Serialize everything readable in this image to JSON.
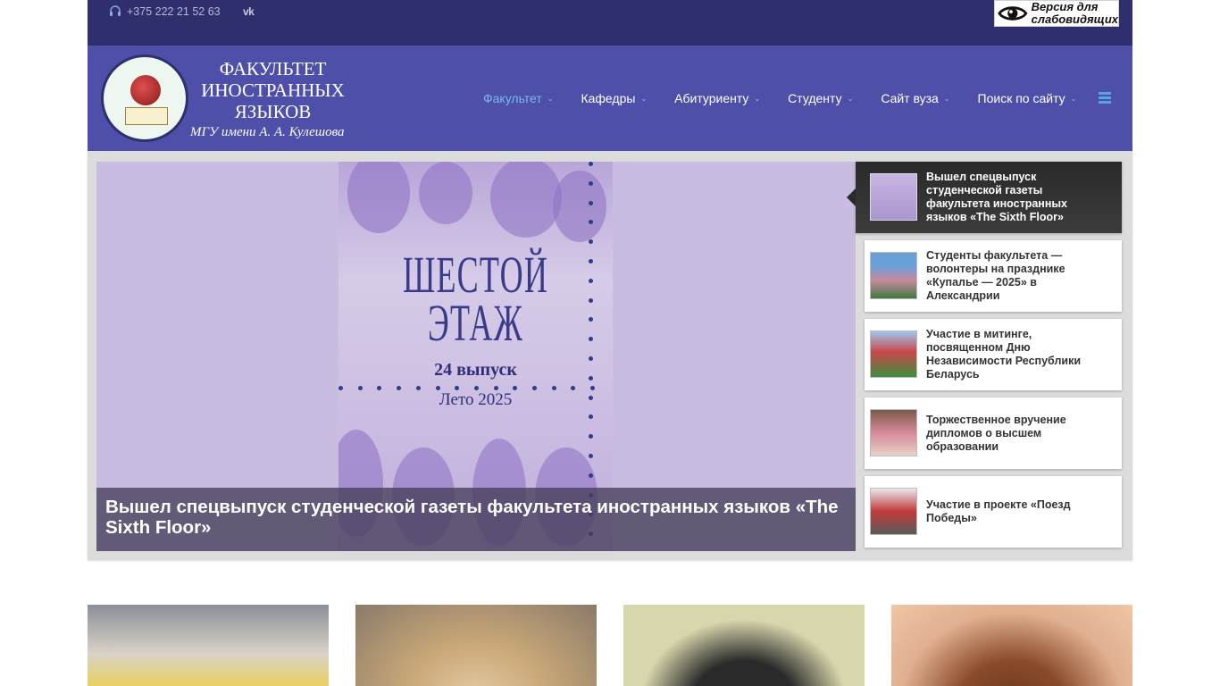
{
  "topbar": {
    "phone": "+375 222 21 52 63",
    "social": "vk",
    "accessibility_label_line1": "Версия для",
    "accessibility_label_line2": "слабовидящих"
  },
  "header": {
    "brand_line1": "ФАКУЛЬТЕТ",
    "brand_line2": "ИНОСТРАННЫХ",
    "brand_line3": "ЯЗЫКОВ",
    "brand_sub": "МГУ имени А. А. Кулешова"
  },
  "nav": {
    "items": [
      {
        "label": "Факультет",
        "active": true
      },
      {
        "label": "Кафедры",
        "active": false
      },
      {
        "label": "Абитуриенту",
        "active": false
      },
      {
        "label": "Студенту",
        "active": false
      },
      {
        "label": "Сайт вуза",
        "active": false
      },
      {
        "label": "Поиск по сайту",
        "active": false
      }
    ]
  },
  "slider": {
    "poster": {
      "title": "ШЕСТОЙ ЭТАЖ",
      "issue": "24 выпуск",
      "season": "Лето 2025"
    },
    "caption": "Вышел спецвыпуск студенческой газеты факультета иностранных языков «The Sixth Floor»",
    "news": [
      {
        "title": "Вышел спецвыпуск студенческой газеты факультета иностранных языков «The Sixth Floor»",
        "active": true
      },
      {
        "title": "Студенты факультета — волонтеры на празднике «Купалье — 2025» в Александрии",
        "active": false
      },
      {
        "title": "Участие в митинге, посвященном Дню Независимости Республики Беларусь",
        "active": false
      },
      {
        "title": "Торжественное вручение дипломов о высшем образовании",
        "active": false
      },
      {
        "title": "Участие в проекте «Поезд Победы»",
        "active": false
      }
    ]
  },
  "colors": {
    "topbar": "#2f2f6e",
    "header": "#4e4fa8",
    "nav_active": "#79b8ef"
  }
}
